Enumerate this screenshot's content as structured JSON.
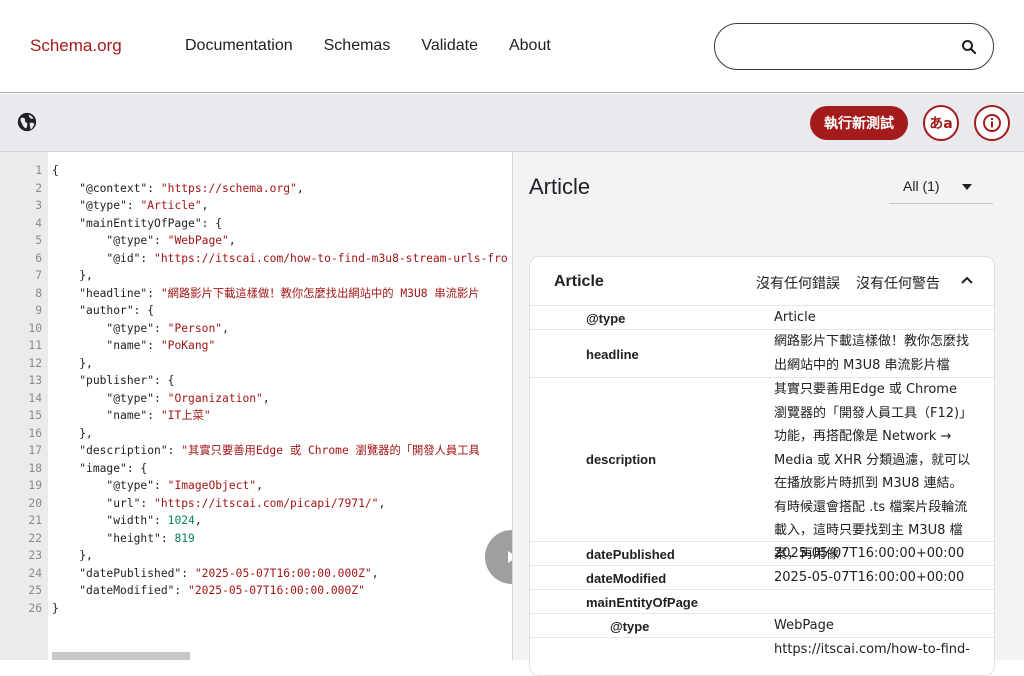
{
  "header": {
    "logo": "Schema.org",
    "nav": [
      "Documentation",
      "Schemas",
      "Validate",
      "About"
    ],
    "search": {
      "value": "",
      "placeholder": ""
    }
  },
  "toolbar": {
    "run_label": "執行新測試",
    "lang_label": "あa"
  },
  "code": {
    "lines": [
      [
        [
          "k",
          "{"
        ]
      ],
      [
        [
          "k",
          "    "
        ],
        [
          "k",
          "\"@context\": "
        ],
        [
          "s",
          "\"https://schema.org\""
        ],
        [
          "k",
          ","
        ]
      ],
      [
        [
          "k",
          "    "
        ],
        [
          "k",
          "\"@type\": "
        ],
        [
          "s",
          "\"Article\""
        ],
        [
          "k",
          ","
        ]
      ],
      [
        [
          "k",
          "    "
        ],
        [
          "k",
          "\"mainEntityOfPage\": {"
        ]
      ],
      [
        [
          "k",
          "        "
        ],
        [
          "k",
          "\"@type\": "
        ],
        [
          "s",
          "\"WebPage\""
        ],
        [
          "k",
          ","
        ]
      ],
      [
        [
          "k",
          "        "
        ],
        [
          "k",
          "\"@id\": "
        ],
        [
          "s",
          "\"https://itscai.com/how-to-find-m3u8-stream-urls-fro"
        ]
      ],
      [
        [
          "k",
          "    },"
        ]
      ],
      [
        [
          "k",
          "    "
        ],
        [
          "k",
          "\"headline\": "
        ],
        [
          "s",
          "\"網路影片下載這樣做！教你怎麼找出網站中的 M3U8 串流影片"
        ]
      ],
      [
        [
          "k",
          "    "
        ],
        [
          "k",
          "\"author\": {"
        ]
      ],
      [
        [
          "k",
          "        "
        ],
        [
          "k",
          "\"@type\": "
        ],
        [
          "s",
          "\"Person\""
        ],
        [
          "k",
          ","
        ]
      ],
      [
        [
          "k",
          "        "
        ],
        [
          "k",
          "\"name\": "
        ],
        [
          "s",
          "\"PoKang\""
        ]
      ],
      [
        [
          "k",
          "    },"
        ]
      ],
      [
        [
          "k",
          "    "
        ],
        [
          "k",
          "\"publisher\": {"
        ]
      ],
      [
        [
          "k",
          "        "
        ],
        [
          "k",
          "\"@type\": "
        ],
        [
          "s",
          "\"Organization\""
        ],
        [
          "k",
          ","
        ]
      ],
      [
        [
          "k",
          "        "
        ],
        [
          "k",
          "\"name\": "
        ],
        [
          "s",
          "\"IT上菜\""
        ]
      ],
      [
        [
          "k",
          "    },"
        ]
      ],
      [
        [
          "k",
          "    "
        ],
        [
          "k",
          "\"description\": "
        ],
        [
          "s",
          "\"其實只要善用Edge 或 Chrome 瀏覽器的「開發人員工具"
        ]
      ],
      [
        [
          "k",
          "    "
        ],
        [
          "k",
          "\"image\": {"
        ]
      ],
      [
        [
          "k",
          "        "
        ],
        [
          "k",
          "\"@type\": "
        ],
        [
          "s",
          "\"ImageObject\""
        ],
        [
          "k",
          ","
        ]
      ],
      [
        [
          "k",
          "        "
        ],
        [
          "k",
          "\"url\": "
        ],
        [
          "s",
          "\"https://itscai.com/picapi/7971/\""
        ],
        [
          "k",
          ","
        ]
      ],
      [
        [
          "k",
          "        "
        ],
        [
          "k",
          "\"width\": "
        ],
        [
          "n",
          "1024"
        ],
        [
          "k",
          ","
        ]
      ],
      [
        [
          "k",
          "        "
        ],
        [
          "k",
          "\"height\": "
        ],
        [
          "n",
          "819"
        ]
      ],
      [
        [
          "k",
          "    },"
        ]
      ],
      [
        [
          "k",
          "    "
        ],
        [
          "k",
          "\"datePublished\": "
        ],
        [
          "s",
          "\"2025-05-07T16:00:00.000Z\""
        ],
        [
          "k",
          ","
        ]
      ],
      [
        [
          "k",
          "    "
        ],
        [
          "k",
          "\"dateModified\": "
        ],
        [
          "s",
          "\"2025-05-07T16:00:00.000Z\""
        ]
      ],
      [
        [
          "k",
          "}"
        ]
      ]
    ]
  },
  "result": {
    "title": "Article",
    "filter_label": "All (1)",
    "card": {
      "title": "Article",
      "errors": "沒有任何錯誤",
      "warnings": "沒有任何警告",
      "rows": [
        {
          "key": "@type",
          "value": "Article",
          "sub": false
        },
        {
          "key": "headline",
          "value": "網路影片下載這樣做！教你怎麼找出網站中的 M3U8 串流影片檔",
          "sub": false
        },
        {
          "key": "description",
          "value": "其實只要善用Edge 或 Chrome 瀏覽器的「開發人員工具（F12)」功能，再搭配像是 Network → Media 或 XHR 分類過濾，就可以在播放影片時抓到 M3U8 連結。有時候還會搭配 .ts 檔案片段輪流載入，這時只要找到主 M3U8 檔案，再用像",
          "sub": false
        },
        {
          "key": "datePublished",
          "value": "2025-05-07T16:00:00+00:00",
          "sub": false
        },
        {
          "key": "dateModified",
          "value": "2025-05-07T16:00:00+00:00",
          "sub": false
        },
        {
          "key": "mainEntityOfPage",
          "value": "",
          "sub": false
        },
        {
          "key": "@type",
          "value": "WebPage",
          "sub": true
        },
        {
          "key": "",
          "value": "https://itscai.com/how-to-find-",
          "sub": true
        }
      ]
    }
  },
  "colors": {
    "brand": "#a31b1b",
    "string": "#a31515",
    "number": "#098658"
  }
}
